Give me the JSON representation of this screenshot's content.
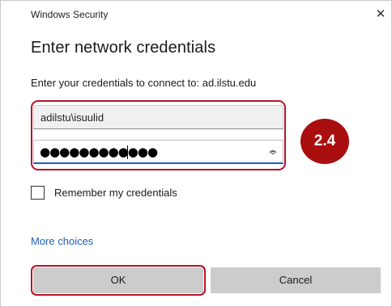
{
  "dialog": {
    "window_title": "Windows Security",
    "heading": "Enter network credentials",
    "prompt": "Enter your credentials to connect to: ad.ilstu.edu",
    "username_value": "adilstu\\isuulid",
    "password_masked": "●●●●●●●●●●●●",
    "remember_label": "Remember my credentials",
    "more_choices": "More choices",
    "ok_label": "OK",
    "cancel_label": "Cancel"
  },
  "annotation": {
    "step_label": "2.4",
    "highlight_color": "#b3162a",
    "badge_color": "#a90f0f"
  },
  "icons": {
    "close": "close-icon",
    "reveal_password": "eye-icon"
  }
}
